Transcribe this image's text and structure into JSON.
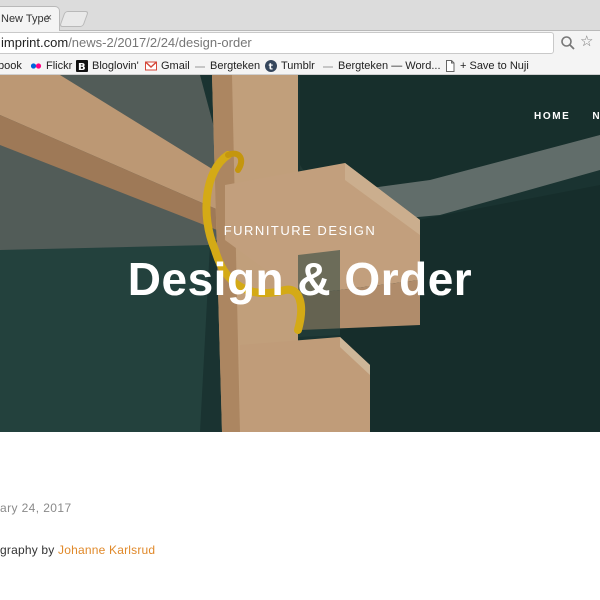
{
  "browser": {
    "tab_title": "New Type",
    "tab_close": "×",
    "url_host": "imprint.com",
    "url_path": "/news-2/2017/2/24/design-order"
  },
  "bookmarks": [
    {
      "label": "book",
      "icon": "facebook-icon"
    },
    {
      "label": "Flickr",
      "icon": "flickr-icon"
    },
    {
      "label": "Bloglovin'",
      "icon": "bloglovin-icon"
    },
    {
      "label": "Gmail",
      "icon": "gmail-icon"
    },
    {
      "label": "Bergteken",
      "icon": "bergteken-icon"
    },
    {
      "label": "Tumblr",
      "icon": "tumblr-icon"
    },
    {
      "label": "Bergteken — Word...",
      "icon": "bergteken-icon"
    },
    {
      "label": "+ Save to Nuji",
      "icon": "page-icon"
    }
  ],
  "nav": {
    "home": "HOME",
    "next": "NE"
  },
  "hero": {
    "kicker": "FURNITURE DESIGN",
    "title": "Design & Order"
  },
  "article": {
    "date": "ary 24, 2017",
    "credit_prefix": "graphy by ",
    "credit_name": "Johanne Karlsrud"
  },
  "colors": {
    "accent_link": "#e0892a",
    "hero_background": "#1f3e3b",
    "wood": "#d9b48f",
    "strap": "#f2c21a"
  }
}
